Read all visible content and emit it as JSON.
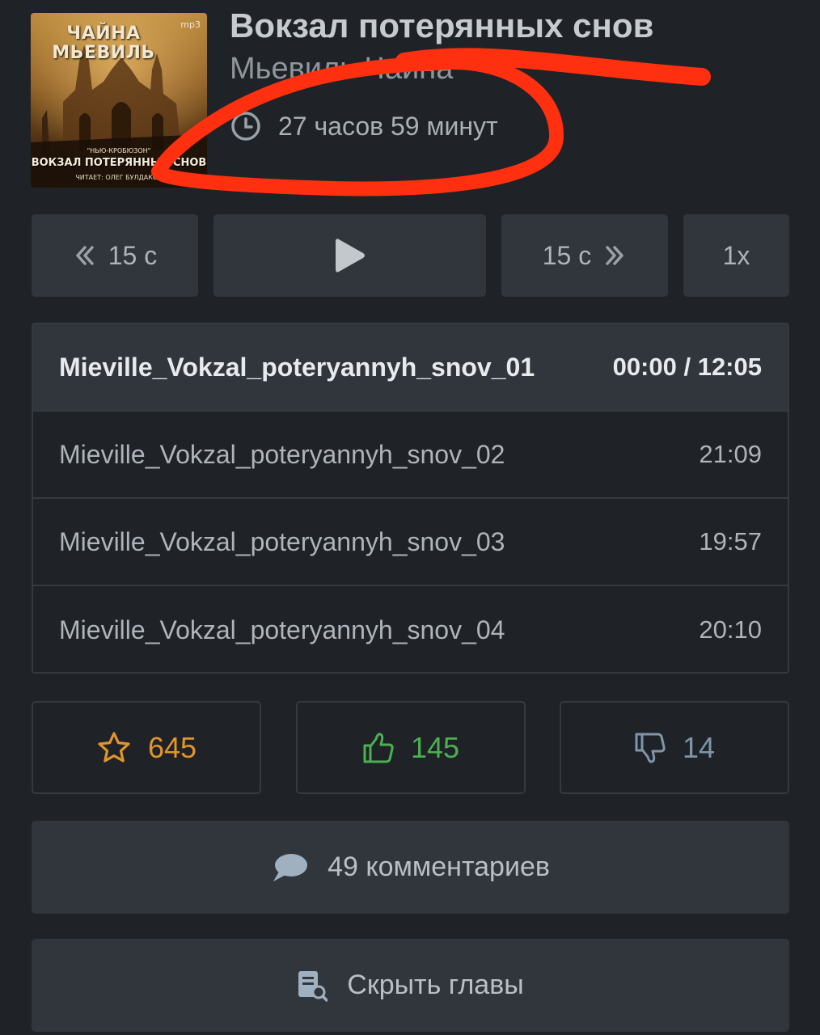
{
  "book": {
    "cover": {
      "author": "ЧАЙНА МЬЕВИЛЬ",
      "format": "mp3",
      "series": "\"НЬЮ-КРОБЮЗОН\"",
      "title": "ВОКЗАЛ ПОТЕРЯННЫХ СНОВ",
      "reader": "ЧИТАЕТ: ОЛЕГ БУЛДАКОВ"
    },
    "title": "Вокзал потерянных снов",
    "author": "Мьевиль Чайна",
    "duration": "27 часов 59 минут"
  },
  "controls": {
    "rewind_label": "15 с",
    "forward_label": "15 с",
    "speed_label": "1x",
    "rewind_icon": "double-chevron-left-icon",
    "play_icon": "play-icon",
    "forward_icon": "double-chevron-right-icon"
  },
  "chapters": [
    {
      "name": "Mieville_Vokzal_poteryannyh_snov_01",
      "time": "00:00 / 12:05",
      "active": true
    },
    {
      "name": "Mieville_Vokzal_poteryannyh_snov_02",
      "time": "21:09",
      "active": false
    },
    {
      "name": "Mieville_Vokzal_poteryannyh_snov_03",
      "time": "19:57",
      "active": false
    },
    {
      "name": "Mieville_Vokzal_poteryannyh_snov_04",
      "time": "20:10",
      "active": false
    }
  ],
  "ratings": {
    "favorites": {
      "count": "645",
      "icon": "star-icon",
      "color": "#e2952b"
    },
    "likes": {
      "count": "145",
      "icon": "thumbs-up-icon",
      "color": "#4cb050"
    },
    "dislikes": {
      "count": "14",
      "icon": "thumbs-down-icon",
      "color": "#7f95aa"
    }
  },
  "comments_label": "49 комментариев",
  "hide_chapters_label": "Скрыть главы",
  "colors": {
    "background": "#1f2327",
    "panel": "#31363c",
    "annotation": "#ff3010"
  }
}
